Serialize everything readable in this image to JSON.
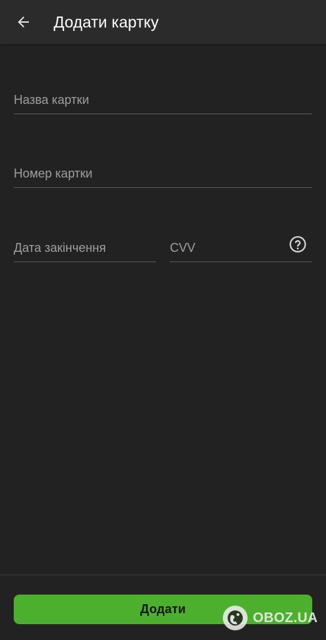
{
  "app_bar": {
    "title": "Додати картку",
    "back_icon": "arrow-left-icon"
  },
  "form": {
    "card_name": {
      "placeholder": "Назва картки",
      "value": ""
    },
    "card_number": {
      "placeholder": "Номер картки",
      "value": ""
    },
    "expiry_date": {
      "placeholder": "Дата закінчення",
      "value": ""
    },
    "cvv": {
      "placeholder": "CVV",
      "value": "",
      "help_icon": "help-circle-icon"
    }
  },
  "actions": {
    "add_label": "Додати"
  },
  "watermark": {
    "text": "OBOZ.UA"
  },
  "colors": {
    "background": "#222222",
    "app_bar": "#2b2b2b",
    "accent_green": "#4caf2e",
    "divider": "#5a5a5a",
    "placeholder": "#9e9e9e"
  }
}
